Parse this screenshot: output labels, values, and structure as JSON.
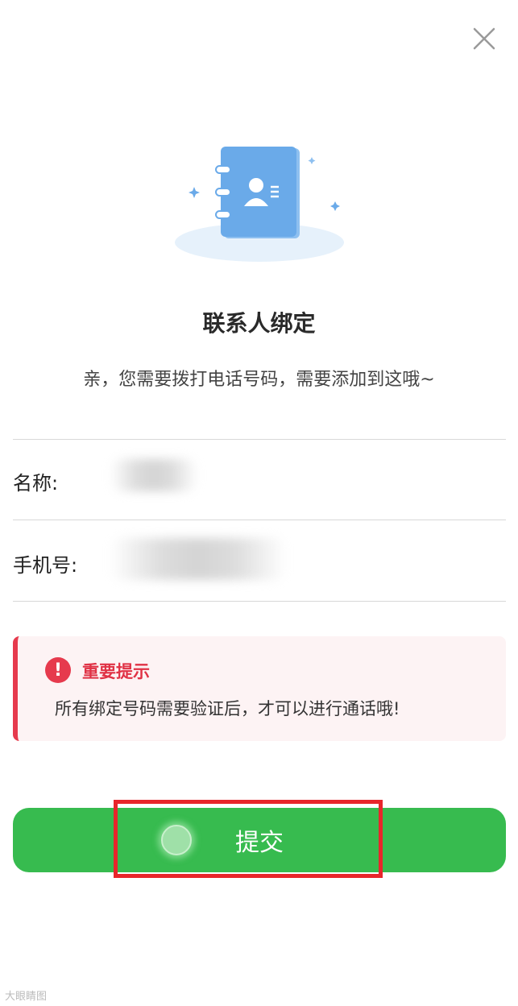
{
  "dialog": {
    "title": "联系人绑定",
    "subtitle": "亲，您需要拨打电话号码，需要添加到这哦~",
    "close_icon": "close-icon"
  },
  "form": {
    "name_label": "名称:",
    "phone_label": "手机号:"
  },
  "notice": {
    "title": "重要提示",
    "text": "所有绑定号码需要验证后，才可以进行通话哦!",
    "icon": "exclamation-icon",
    "accent_color": "#e63a4d"
  },
  "submit": {
    "label": "提交",
    "color": "#37bb4f"
  },
  "watermark": {
    "text": "大眼睛图"
  }
}
